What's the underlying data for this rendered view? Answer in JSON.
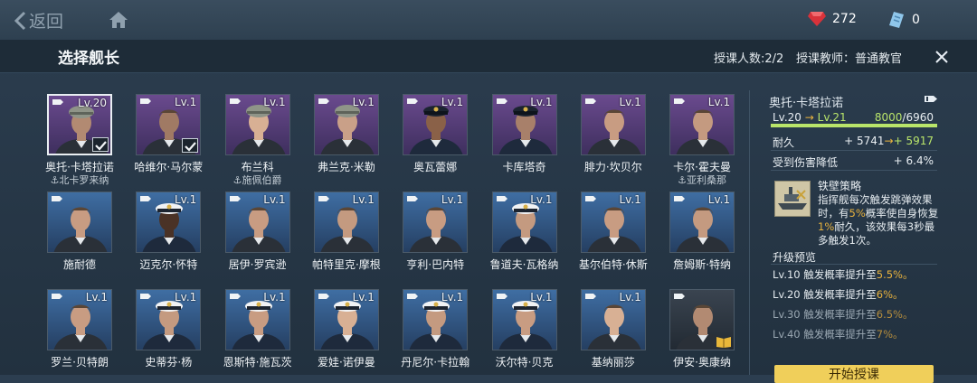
{
  "topbar": {
    "back_label": "返回",
    "ruby_count": "272",
    "ticket_count": "0"
  },
  "header": {
    "title": "选择舰长",
    "student_count": "授课人数:2/2",
    "teacher": "授课教师：普通教官"
  },
  "colors": {
    "accent": "#b9e56a",
    "highlight": "#e8b23e",
    "button": "#f0cf5a"
  },
  "captains": [
    {
      "name": "奥托·卡塔拉诺",
      "sub": "⚓北卡罗来纳",
      "level": "Lv.20",
      "bg": "purple",
      "checked": true,
      "cap": "officer",
      "skin": "#b28a72"
    },
    {
      "name": "哈维尔·马尔蒙",
      "sub": "",
      "level": "Lv.1",
      "bg": "purple",
      "checked": true,
      "cap": "none",
      "skin": "#a07a64"
    },
    {
      "name": "布兰科",
      "sub": "⚓施佩伯爵",
      "level": "Lv.1",
      "bg": "purple",
      "checked": false,
      "cap": "officer",
      "skin": "#d8b094"
    },
    {
      "name": "弗兰克·米勒",
      "sub": "",
      "level": "Lv.1",
      "bg": "purple",
      "checked": false,
      "cap": "officer",
      "skin": "#c9a088"
    },
    {
      "name": "奥瓦蕾娜",
      "sub": "",
      "level": "Lv.1",
      "bg": "purple",
      "checked": false,
      "cap": "navy",
      "skin": "#8a6148"
    },
    {
      "name": "卡库塔奇",
      "sub": "",
      "level": "Lv.1",
      "bg": "purple",
      "checked": false,
      "cap": "navy",
      "skin": "#a8806a"
    },
    {
      "name": "腓力·坎贝尔",
      "sub": "",
      "level": "Lv.1",
      "bg": "purple",
      "checked": false,
      "cap": "none",
      "skin": "#c89c82"
    },
    {
      "name": "卡尔·霍夫曼",
      "sub": "⚓亚利桑那",
      "level": "Lv.1",
      "bg": "purple",
      "checked": false,
      "cap": "none",
      "skin": "#c49a80"
    },
    {
      "name": "施耐德",
      "sub": "",
      "level": "",
      "bg": "blue",
      "checked": false,
      "cap": "none",
      "skin": "#c89c82"
    },
    {
      "name": "迈克尔·怀特",
      "sub": "",
      "level": "Lv.1",
      "bg": "blue",
      "checked": false,
      "cap": "white",
      "skin": "#4a3226"
    },
    {
      "name": "居伊·罗宾逊",
      "sub": "",
      "level": "Lv.1",
      "bg": "blue",
      "checked": false,
      "cap": "none",
      "skin": "#c89c82"
    },
    {
      "name": "帕特里克·摩根",
      "sub": "",
      "level": "Lv.1",
      "bg": "blue",
      "checked": false,
      "cap": "none",
      "skin": "#c49a80"
    },
    {
      "name": "亨利·巴内特",
      "sub": "",
      "level": "Lv.1",
      "bg": "blue",
      "checked": false,
      "cap": "none",
      "skin": "#c89c82"
    },
    {
      "name": "鲁道夫·瓦格纳",
      "sub": "",
      "level": "Lv.1",
      "bg": "blue",
      "checked": false,
      "cap": "white",
      "skin": "#c49a80"
    },
    {
      "name": "基尔伯特·休斯",
      "sub": "",
      "level": "Lv.1",
      "bg": "blue",
      "checked": false,
      "cap": "none",
      "skin": "#c89c82"
    },
    {
      "name": "詹姆斯·特纳",
      "sub": "",
      "level": "Lv.1",
      "bg": "blue",
      "checked": false,
      "cap": "none",
      "skin": "#c49a80"
    },
    {
      "name": "罗兰·贝特朗",
      "sub": "",
      "level": "Lv.1",
      "bg": "blue",
      "checked": false,
      "cap": "none",
      "skin": "#c89c82"
    },
    {
      "name": "史蒂芬·杨",
      "sub": "",
      "level": "Lv.1",
      "bg": "blue",
      "checked": false,
      "cap": "white",
      "skin": "#c49a80"
    },
    {
      "name": "恩斯特·施瓦茨",
      "sub": "",
      "level": "Lv.1",
      "bg": "blue",
      "checked": false,
      "cap": "white",
      "skin": "#c89c82"
    },
    {
      "name": "爱娃·诺伊曼",
      "sub": "",
      "level": "Lv.1",
      "bg": "blue",
      "checked": false,
      "cap": "white",
      "skin": "#d8b094"
    },
    {
      "name": "丹尼尔·卡拉翰",
      "sub": "",
      "level": "Lv.1",
      "bg": "blue",
      "checked": false,
      "cap": "white",
      "skin": "#c49a80"
    },
    {
      "name": "沃尔特·贝克",
      "sub": "",
      "level": "Lv.1",
      "bg": "blue",
      "checked": false,
      "cap": "white",
      "skin": "#c89c82"
    },
    {
      "name": "基纳丽莎",
      "sub": "",
      "level": "Lv.1",
      "bg": "blue",
      "checked": false,
      "cap": "none",
      "skin": "#d8b094"
    },
    {
      "name": "伊安·奥康纳",
      "sub": "",
      "level": "",
      "bg": "dark",
      "checked": false,
      "cap": "none",
      "skin": "#b28a72",
      "book": true
    }
  ],
  "detail": {
    "name": "奥托·卡塔拉诺",
    "level_from": "Lv.20",
    "arrow": "→",
    "level_to": "Lv.21",
    "exp_current": "8000",
    "exp_sep": "/",
    "exp_max": "6960",
    "exp_fraction": 1.0,
    "stat1_label": "耐久",
    "stat1_from": "+ 5741",
    "stat1_to": "+ 5917",
    "stat2_label": "受到伤害降低",
    "stat2_value": "+ 6.4%",
    "skill_name": "铁壁策略",
    "skill_desc_1": "指挥舰每次触发跳弹效果时，有",
    "skill_desc_hl1": "5%",
    "skill_desc_2": "概率使自身恢复",
    "skill_desc_hl2": "1%",
    "skill_desc_3": "耐久，该效果每3秒最多触发1次。",
    "upgrade_title": "升级预览",
    "upgrades": [
      {
        "lv": "Lv.10",
        "text": "触发概率提升至",
        "val": "5.5%",
        "dim": false
      },
      {
        "lv": "Lv.20",
        "text": "触发概率提升至",
        "val": "6%",
        "dim": false
      },
      {
        "lv": "Lv.30",
        "text": "触发概率提升至",
        "val": "6.5%",
        "dim": true
      },
      {
        "lv": "Lv.40",
        "text": "触发概率提升至",
        "val": "7%",
        "dim": true
      }
    ],
    "confirm_label": "开始授课"
  }
}
